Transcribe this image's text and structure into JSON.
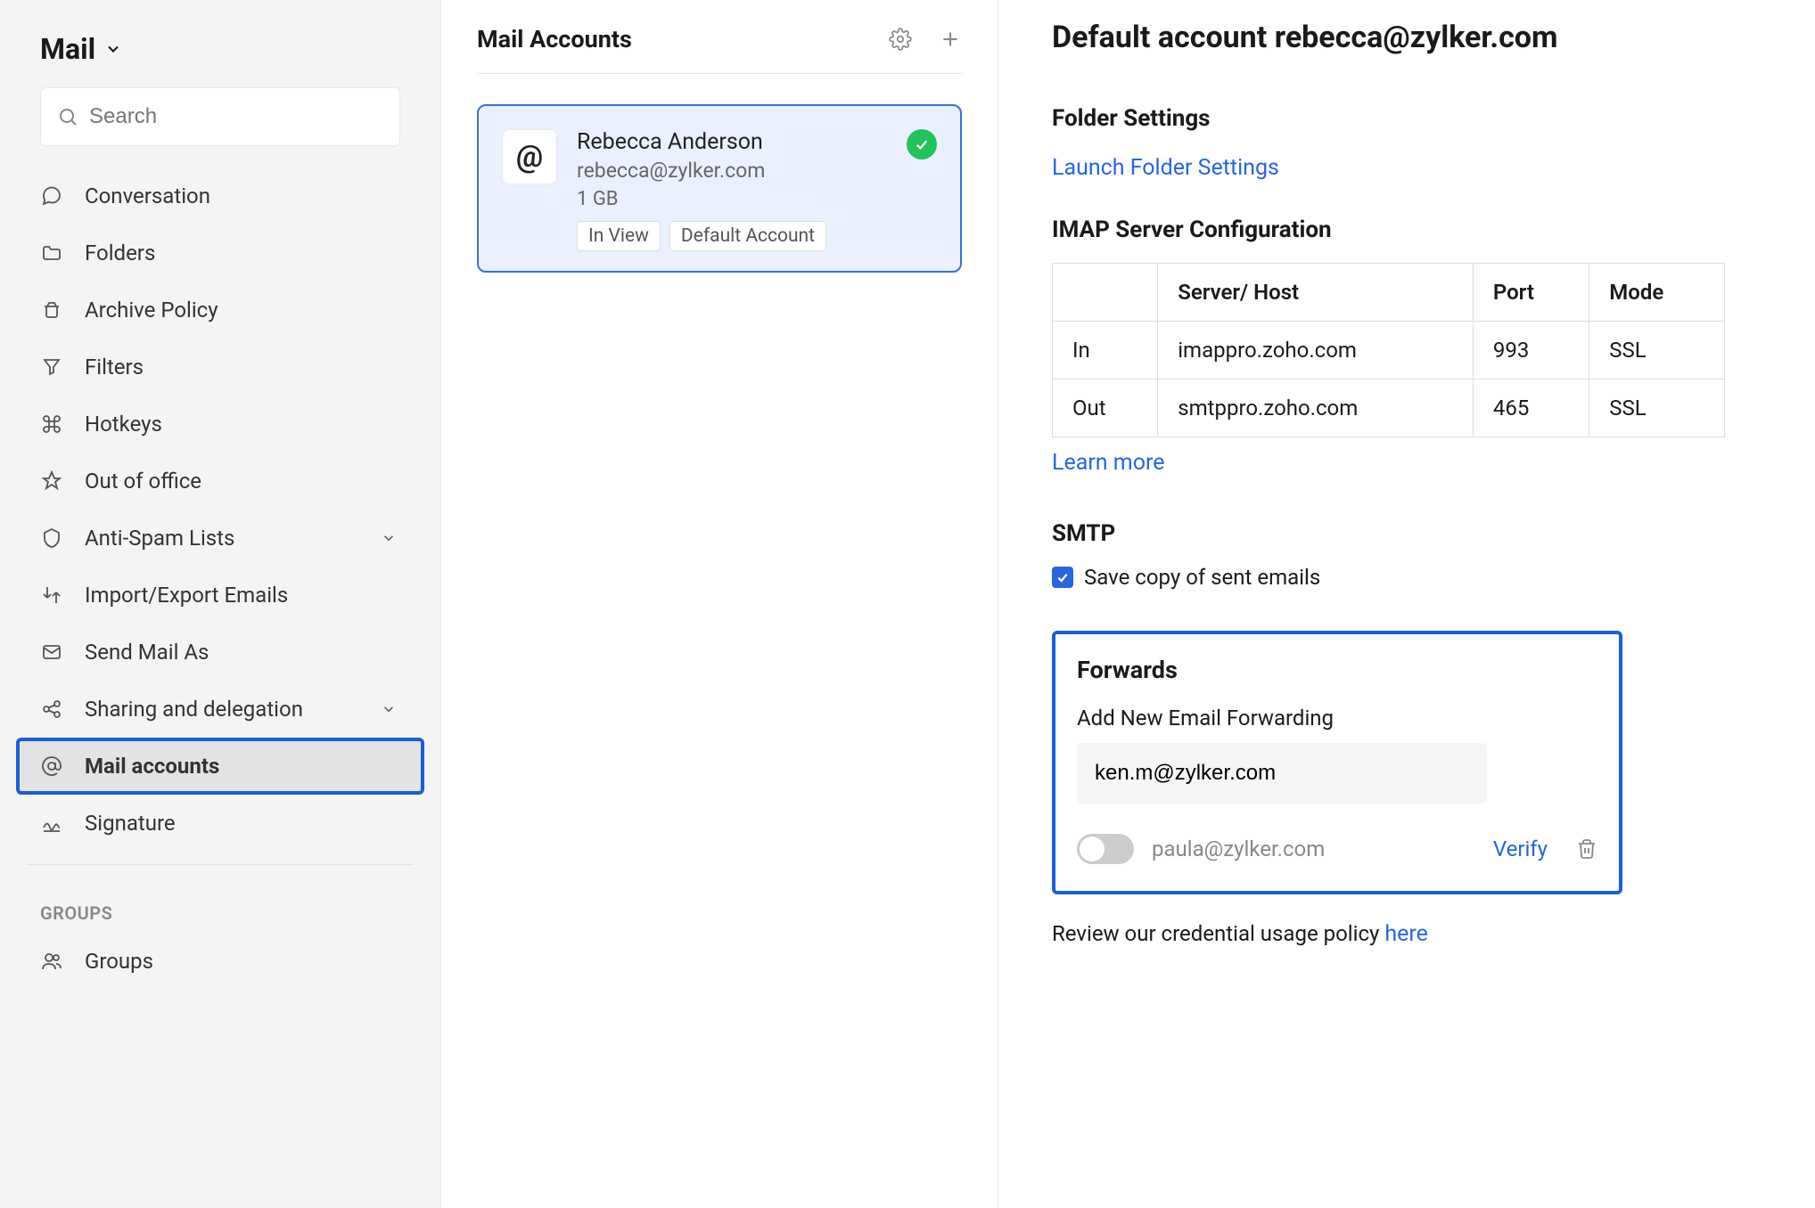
{
  "sidebar": {
    "title": "Mail",
    "search_placeholder": "Search",
    "items": [
      {
        "label": "Conversation"
      },
      {
        "label": "Folders"
      },
      {
        "label": "Archive Policy"
      },
      {
        "label": "Filters"
      },
      {
        "label": "Hotkeys"
      },
      {
        "label": "Out of office"
      },
      {
        "label": "Anti-Spam Lists"
      },
      {
        "label": "Import/Export Emails"
      },
      {
        "label": "Send Mail As"
      },
      {
        "label": "Sharing and delegation"
      },
      {
        "label": "Mail accounts"
      },
      {
        "label": "Signature"
      }
    ],
    "group_label": "GROUPS",
    "group_item": "Groups"
  },
  "middle": {
    "title": "Mail Accounts",
    "account": {
      "name": "Rebecca Anderson",
      "email": "rebecca@zylker.com",
      "size": "1 GB",
      "badge1": "In View",
      "badge2": "Default Account"
    }
  },
  "detail": {
    "title": "Default account rebecca@zylker.com",
    "folder_heading": "Folder Settings",
    "folder_link": "Launch Folder Settings",
    "imap_heading": "IMAP Server Configuration",
    "imap_table": {
      "col_server": "Server/ Host",
      "col_port": "Port",
      "col_mode": "Mode",
      "rows": [
        {
          "dir": "In",
          "host": "imappro.zoho.com",
          "port": "993",
          "mode": "SSL"
        },
        {
          "dir": "Out",
          "host": "smtppro.zoho.com",
          "port": "465",
          "mode": "SSL"
        }
      ]
    },
    "learn_more": "Learn more",
    "smtp_heading": "SMTP",
    "smtp_checkbox": "Save copy of sent emails",
    "forwards": {
      "heading": "Forwards",
      "sub": "Add New Email Forwarding",
      "input_value": "ken.m@zylker.com",
      "pending_email": "paula@zylker.com",
      "verify": "Verify"
    },
    "policy_text": "Review our credential usage policy ",
    "policy_link": "here"
  }
}
